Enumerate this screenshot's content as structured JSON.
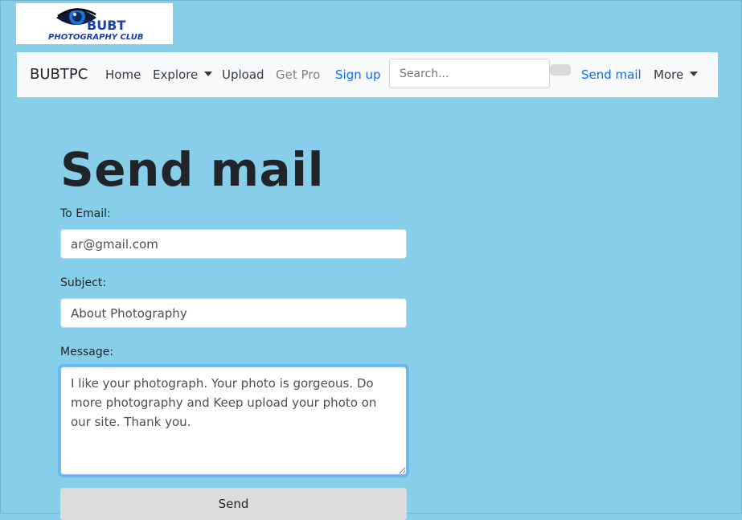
{
  "logo": {
    "title": "BUBT",
    "subtitle": "PHOTOGRAPHY CLUB"
  },
  "navbar": {
    "brand": "BUBTPC",
    "items": [
      {
        "label": "Home"
      },
      {
        "label": "Explore"
      },
      {
        "label": "Upload"
      },
      {
        "label": "Get Pro"
      },
      {
        "label": "Sign up"
      }
    ],
    "search_placeholder": "Search...",
    "send_mail_label": "Send mail",
    "more_label": "More"
  },
  "form": {
    "title": "Send mail",
    "to_label": "To Email:",
    "to_value": "ar@gmail.com",
    "subject_label": "Subject:",
    "subject_value": "About Photography",
    "message_label": "Message:",
    "message_value": "I like your photograph. Your photo is gorgeous. Do more photography and Keep upload your photo on our site. Thank you.",
    "send_label": "Send"
  },
  "colors": {
    "page_background": "#87ceeb",
    "navbar_background": "#f8f9fa",
    "link_blue": "#0d6efd",
    "logo_blue": "#1a3fb0"
  }
}
